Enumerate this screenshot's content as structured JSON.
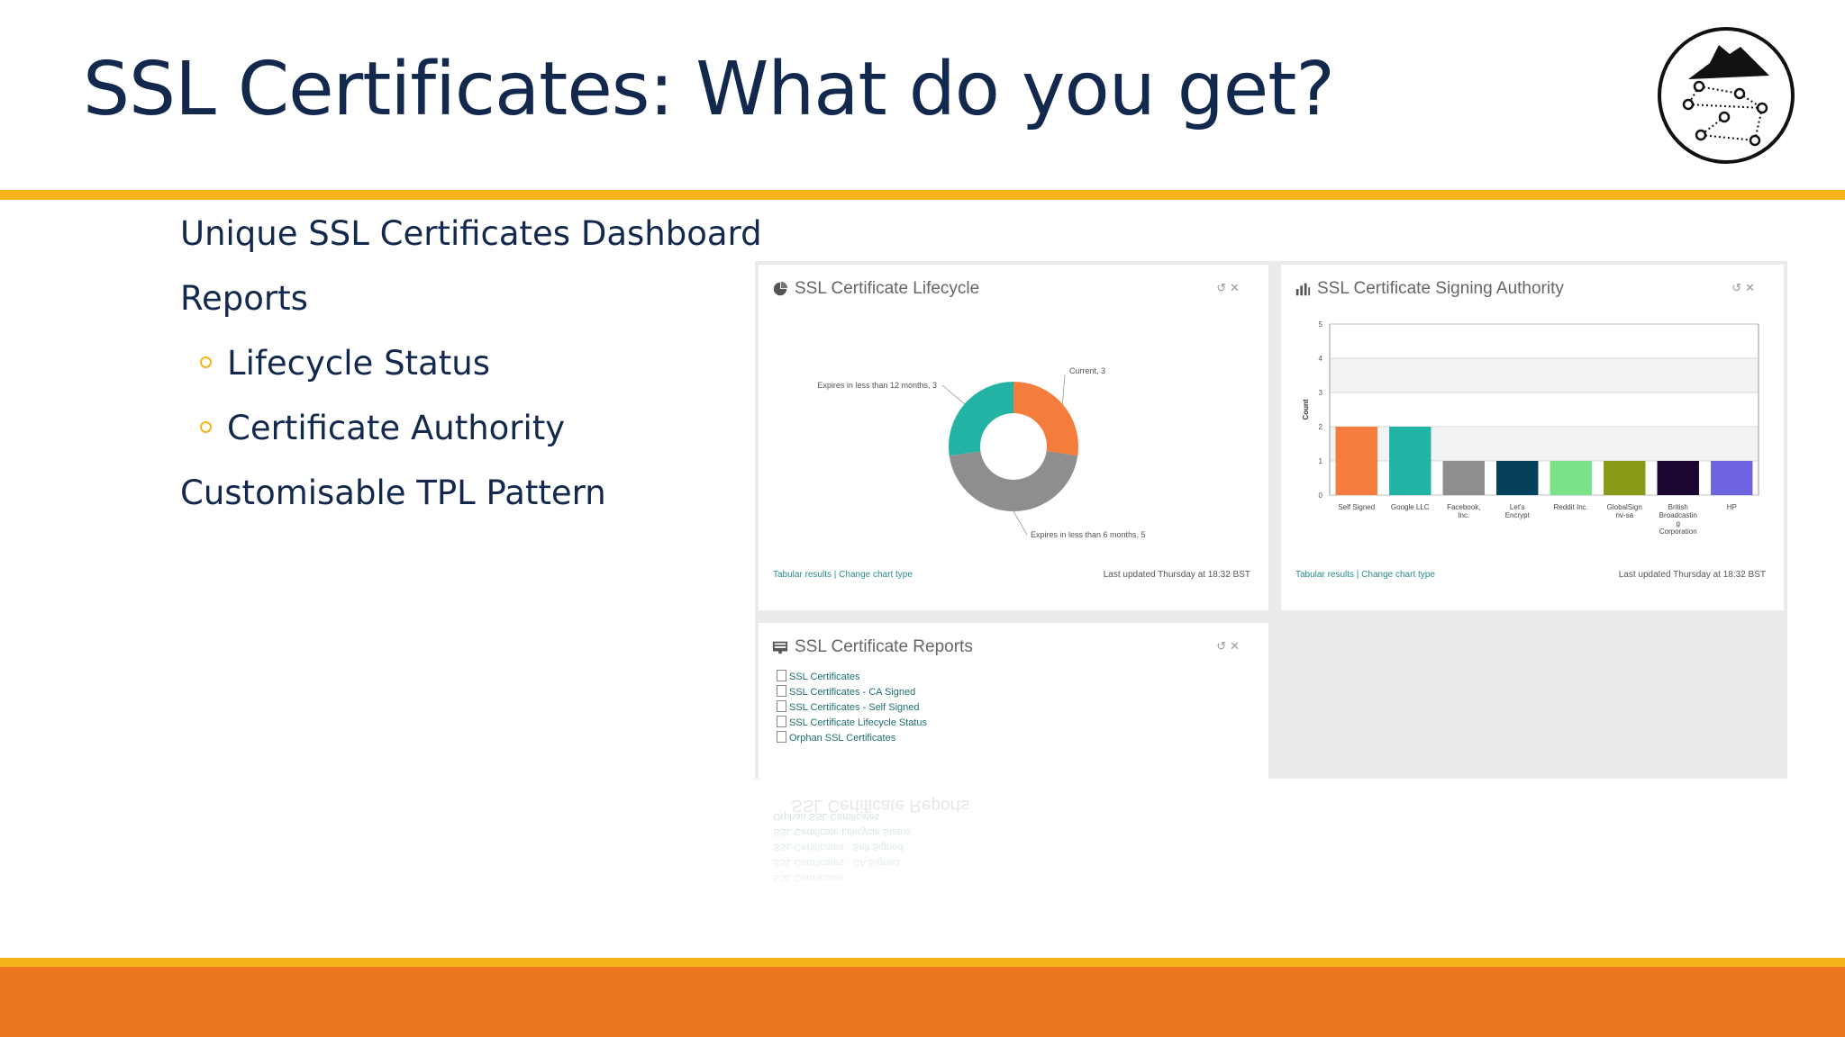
{
  "slide": {
    "title": "SSL Certificates: What do you get?",
    "bullets": [
      "Unique SSL Certificates Dashboard",
      "Reports",
      "Lifecycle Status",
      "Certificate Authority",
      "Customisable TPL Pattern"
    ]
  },
  "colors": {
    "title": "#13284d",
    "accent_yellow": "#f4b41a",
    "accent_orange": "#ec7620",
    "link": "#1d6f6f"
  },
  "panels": {
    "lifecycle": {
      "title": "SSL Certificate Lifecycle",
      "footer_left": "Tabular results | Change chart type",
      "footer_right": "Last updated Thursday at 18:32 BST"
    },
    "authority": {
      "title": "SSL Certificate Signing Authority",
      "footer_left": "Tabular results | Change chart type",
      "footer_right": "Last updated Thursday at 18:32 BST"
    },
    "reports": {
      "title": "SSL Certificate Reports",
      "items": [
        "SSL Certificates",
        "SSL Certificates - CA Signed",
        "SSL Certificates - Self Signed",
        "SSL Certificate Lifecycle Status",
        "Orphan SSL Certificates"
      ]
    }
  },
  "chart_data": [
    {
      "type": "pie",
      "categories": [
        "Current",
        "Expires in less than 6 months",
        "Expires in less than 12 months"
      ],
      "values": [
        3,
        5,
        3
      ],
      "labels": [
        "Current, 3",
        "Expires in less than 6 months, 5",
        "Expires in less than 12 months, 3"
      ],
      "colors": [
        "#f47c3c",
        "#8e8e8e",
        "#22b3a4"
      ]
    },
    {
      "type": "bar",
      "categories": [
        "Self Signed",
        "Google LLC",
        "Facebook, Inc.",
        "Let's Encrypt",
        "Reddit Inc.",
        "GlobalSign nv-sa",
        "British Broadcasting Corporation",
        "HP"
      ],
      "category_lines": [
        [
          "Self Signed"
        ],
        [
          "Google LLC"
        ],
        [
          "Facebook,",
          "Inc."
        ],
        [
          "Let's",
          "Encrypt"
        ],
        [
          "Reddit Inc."
        ],
        [
          "GlobalSign",
          "nv-sa"
        ],
        [
          "British",
          "Broadcastin",
          "g",
          "Corporation"
        ],
        [
          "HP"
        ]
      ],
      "values": [
        2,
        2,
        1,
        1,
        1,
        1,
        1,
        1
      ],
      "colors": [
        "#f47c3c",
        "#22b3a4",
        "#8e8e8e",
        "#06415c",
        "#7be38a",
        "#8a9a18",
        "#1a0630",
        "#6f64e0"
      ],
      "ylabel": "Count",
      "ylim": [
        0,
        5
      ],
      "yticks": [
        0,
        1,
        2,
        3,
        4,
        5
      ]
    }
  ]
}
